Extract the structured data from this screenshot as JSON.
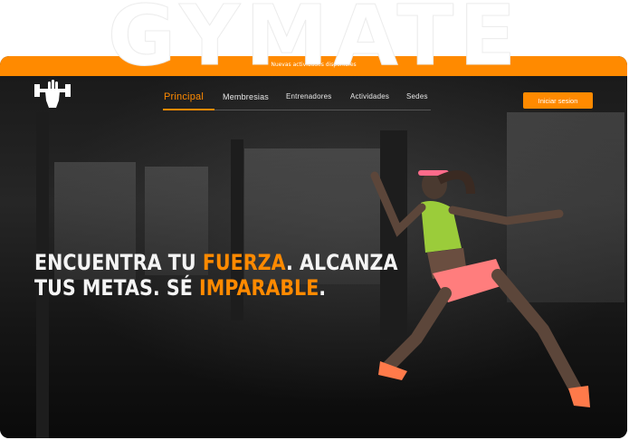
{
  "brand": {
    "name": "GYMATE"
  },
  "announcement": {
    "text": "Nuevas actividades disponibles"
  },
  "nav": {
    "items": [
      {
        "label": "Principal",
        "active": true
      },
      {
        "label": "Membresias",
        "active": false
      },
      {
        "label": "Entrenadores",
        "active": false
      },
      {
        "label": "Actividades",
        "active": false
      },
      {
        "label": "Sedes",
        "active": false
      }
    ],
    "login_label": "Iniciar sesion"
  },
  "hero": {
    "line1_a": "ENCUENTRA TU ",
    "line1_b": "FUERZA",
    "line1_c": ". ALCANZA",
    "line2_a": "TUS METAS. SÉ ",
    "line2_b": "IMPARABLE",
    "line2_c": "."
  },
  "colors": {
    "accent": "#ff8a00",
    "background": "#0c0c0c",
    "text": "#f4f4f4"
  },
  "icons": {
    "logo": "dumbbell-fist-icon"
  }
}
